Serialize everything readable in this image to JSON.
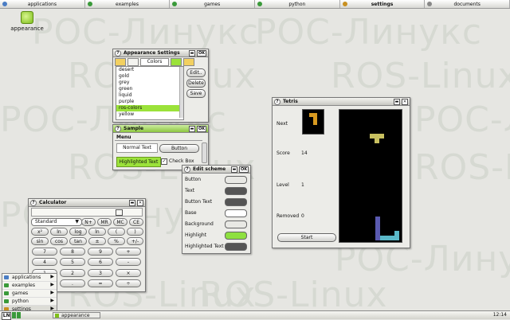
{
  "watermark": {
    "cyrillic": "РОС-Линукс",
    "latin": "ROS-Linux"
  },
  "topbar": {
    "tabs": [
      {
        "label": "applications",
        "icon": "cube-icon",
        "color": "#4a7dc4"
      },
      {
        "label": "examples",
        "icon": "leaf-icon",
        "color": "#3a9a3a"
      },
      {
        "label": "games",
        "icon": "gamepad-icon",
        "color": "#3a9a3a"
      },
      {
        "label": "python",
        "icon": "python-icon",
        "color": "#3a9a3a"
      },
      {
        "label": "settings",
        "icon": "wrench-icon",
        "color": "#c89020",
        "active": true
      },
      {
        "label": "documents",
        "icon": "page-icon",
        "color": "#888888"
      }
    ]
  },
  "desktop_icon": {
    "label": "appearance"
  },
  "appearance": {
    "title": "Appearance Settings",
    "colors_tab": "Colors",
    "list": [
      "desert",
      "gold",
      "grey",
      "green",
      "liquid",
      "purple",
      "ros-colors",
      "yellow"
    ],
    "selected": "ros-colors",
    "edit": "Edit..",
    "delete": "Delete",
    "save": "Save",
    "ok": "OK"
  },
  "sample": {
    "title": "Sample",
    "ok": "OK",
    "menu": "Menu",
    "normal_text": "Normal Text",
    "button": "Button",
    "highlighted_text": "Highlighted Text",
    "checkbox": "Check Box"
  },
  "edit_scheme": {
    "title": "Edit scheme",
    "ok": "OK",
    "rows": [
      {
        "label": "Button",
        "color": "#e8e8e4"
      },
      {
        "label": "Text",
        "color": "#555555"
      },
      {
        "label": "Button Text",
        "color": "#555555"
      },
      {
        "label": "Base",
        "color": "#ffffff"
      },
      {
        "label": "Background",
        "color": "#e8e8e4"
      },
      {
        "label": "Highlight",
        "color": "#8ee040"
      },
      {
        "label": "Highlighted Text",
        "color": "#555555"
      }
    ]
  },
  "tetris": {
    "title": "Tetris",
    "next_label": "Next",
    "score_label": "Score",
    "score": "14",
    "level_label": "Level",
    "level": "1",
    "removed_label": "Removed",
    "removed": "0",
    "start": "Start"
  },
  "calculator": {
    "title": "Calculator",
    "mode": "Standard",
    "buttons": [
      [
        "N+",
        "MR",
        "MC",
        "CE"
      ],
      [
        "x²",
        "ln",
        "log",
        "ln",
        "(",
        ")"
      ],
      [
        "sin",
        "cos",
        "tan",
        "±",
        "%",
        "+/-"
      ],
      [
        "7",
        "8",
        "9",
        "+"
      ],
      [
        "4",
        "5",
        "6",
        "-"
      ],
      [
        "1",
        "2",
        "3",
        "×"
      ],
      [
        "0",
        ".",
        "=",
        "÷"
      ]
    ]
  },
  "start_menu": {
    "items": [
      {
        "label": "applications",
        "color": "#4a7dc4"
      },
      {
        "label": "examples",
        "color": "#3a9a3a"
      },
      {
        "label": "games",
        "color": "#3a9a3a"
      },
      {
        "label": "python",
        "color": "#3a9a3a"
      },
      {
        "label": "settings",
        "color": "#c89020"
      }
    ]
  },
  "taskbar": {
    "item": "appearance",
    "time": "12:14"
  }
}
